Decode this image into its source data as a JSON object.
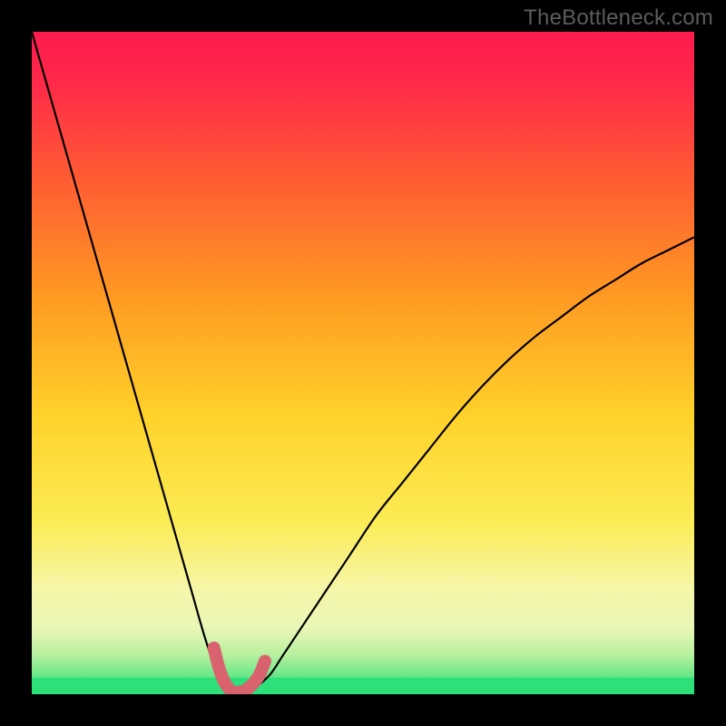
{
  "watermark": "TheBottleneck.com",
  "chart_data": {
    "type": "line",
    "title": "",
    "xlabel": "",
    "ylabel": "",
    "xlim": [
      0,
      100
    ],
    "ylim": [
      0,
      100
    ],
    "grid": false,
    "legend": false,
    "annotations": [],
    "background_gradient": {
      "top_color": "#ff1a4f",
      "mid_colors": [
        "#ff6a2b",
        "#ffd230",
        "#f9f59a"
      ],
      "bottom_color": "#2de07a"
    },
    "series": [
      {
        "name": "bottleneck-curve",
        "color": "#000000",
        "x": [
          0,
          2,
          4,
          6,
          8,
          10,
          12,
          14,
          16,
          18,
          20,
          22,
          24,
          26,
          28,
          29,
          30,
          31,
          32,
          33,
          34,
          36,
          38,
          40,
          44,
          48,
          52,
          56,
          60,
          64,
          68,
          72,
          76,
          80,
          84,
          88,
          92,
          96,
          100
        ],
        "y": [
          100,
          93,
          86,
          79,
          72,
          65,
          58,
          51,
          44,
          37,
          30,
          23,
          16,
          9,
          3,
          1,
          0,
          0,
          0,
          0.5,
          1.2,
          3,
          6,
          9,
          15,
          21,
          27,
          32,
          37,
          42,
          46.5,
          50.5,
          54,
          57,
          60,
          62.5,
          65,
          67,
          69
        ]
      },
      {
        "name": "bottom-highlight",
        "color": "#d9626f",
        "stroke_width": 14,
        "linecap": "round",
        "x": [
          27.5,
          28.2,
          29,
          29.8,
          30.5,
          31.2,
          32,
          32.8,
          33.6,
          34.4,
          35.2
        ],
        "y": [
          7,
          4.2,
          2,
          0.8,
          0.3,
          0.3,
          0.5,
          1,
          1.8,
          3,
          5
        ]
      }
    ],
    "green_band": {
      "y_from": 0,
      "y_to": 2.5,
      "color": "#2de07a"
    }
  }
}
